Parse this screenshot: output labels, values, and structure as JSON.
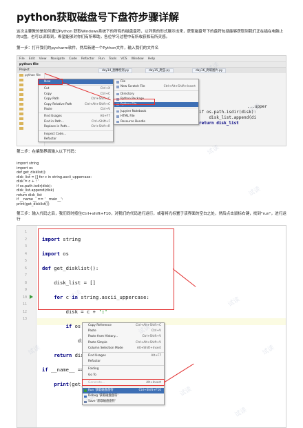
{
  "title": "python获取磁盘号下盘符步骤详解",
  "intro": "这次主要教的是如何通过Python 获取Windows系统下的所有的磁盘盘符，以列表的形式展示出来，获取磁盘号下的盘符包括能够获取到我们正在插在电脑上的U盘，也可以读取到，希望能够对你们有所帮助，各位学习过程中有所收获和有所灵感。",
  "step1": "第一步：打开我们的pycharm软件，然后新建一个Python文件，输入我们的文件名",
  "step2": "第二步：在编辑界面输入以下代码：",
  "step3": "第三步：输入代码之后，我们同时按住Ctrl+shift+F10，对我们的代码进行运行，或者将光标置于该界面的空白之处，然后点击鼠标右键，找到\"run\"，进行运行",
  "code_lines": [
    "import string",
    "import os",
    "def get_disklist():",
    "disk_list = [] for c in string.ascii_uppercase:",
    "disk = c + ':'",
    "if os.path.isdir(disk):",
    "disk_list.append(disk)",
    "return disk_list",
    "if __name__ == '__main__':",
    "print(get_disklist())"
  ],
  "shot1": {
    "menubar": [
      "File",
      "Edit",
      "View",
      "Navigate",
      "Code",
      "Refactor",
      "Run",
      "Tools",
      "VCS",
      "Window",
      "Help"
    ],
    "toolbar_label": "python file",
    "project_label": "Project",
    "tabs": [
      "day14_图像检测.py",
      "day15_爬虫.py",
      "day16_爬取图片.py"
    ],
    "tree_root": "python file",
    "context_menu": [
      {
        "label": "New",
        "shortcut": ""
      },
      {
        "label": "Cut",
        "shortcut": "Ctrl+X"
      },
      {
        "label": "Copy",
        "shortcut": "Ctrl+C"
      },
      {
        "label": "Copy Path",
        "shortcut": "Ctrl+Shift+C"
      },
      {
        "label": "Copy Relative Path",
        "shortcut": "Ctrl+Alt+Shift+C"
      },
      {
        "label": "Paste",
        "shortcut": "Ctrl+V"
      },
      {
        "label": "Find Usages",
        "shortcut": "Alt+F7"
      },
      {
        "label": "Find in Path...",
        "shortcut": "Ctrl+Shift+F"
      },
      {
        "label": "Replace in Path...",
        "shortcut": "Ctrl+Shift+R"
      },
      {
        "label": "Inspect Code...",
        "shortcut": ""
      },
      {
        "label": "Refactor",
        "shortcut": ""
      }
    ],
    "new_submenu": [
      {
        "label": "File",
        "shortcut": ""
      },
      {
        "label": "New Scratch File",
        "shortcut": "Ctrl+Alt+Shift+Insert"
      },
      {
        "label": "Directory",
        "shortcut": ""
      },
      {
        "label": "Python Package",
        "shortcut": ""
      },
      {
        "label": "Python File",
        "shortcut": ""
      },
      {
        "label": "Jupyter Notebook",
        "shortcut": ""
      },
      {
        "label": "HTML File",
        "shortcut": ""
      },
      {
        "label": "Resource Bundle",
        "shortcut": ""
      }
    ],
    "bg_code": [
      "...upper",
      "if os.path.isdir(disk):",
      "    disk_list.append(di",
      "return disk_list"
    ]
  },
  "shot2": {
    "line_numbers": [
      "1",
      "2",
      "3",
      "4",
      "5",
      "6",
      "7",
      "8",
      "9",
      "10",
      "11",
      "12",
      "13"
    ],
    "context_menu": [
      {
        "label": "Copy Reference",
        "shortcut": "Ctrl+Alt+Shift+C",
        "disabled": false
      },
      {
        "label": "Paste",
        "shortcut": "Ctrl+V",
        "disabled": false
      },
      {
        "label": "Paste from History...",
        "shortcut": "Ctrl+Shift+V",
        "disabled": false
      },
      {
        "label": "Paste Simple",
        "shortcut": "Ctrl+Alt+Shift+V",
        "disabled": false
      },
      {
        "label": "Column Selection Mode",
        "shortcut": "Alt+Shift+Insert",
        "disabled": false
      },
      {
        "label": "Find Usages",
        "shortcut": "Alt+F7",
        "disabled": false
      },
      {
        "label": "Refactor",
        "shortcut": "",
        "disabled": false
      },
      {
        "label": "Folding",
        "shortcut": "",
        "disabled": false
      },
      {
        "label": "Go To",
        "shortcut": "",
        "disabled": false
      },
      {
        "label": "Generate...",
        "shortcut": "Alt+Insert",
        "disabled": true
      },
      {
        "label": "Run '获取磁盘盘符'",
        "shortcut": "Ctrl+Shift+F10",
        "disabled": false
      },
      {
        "label": "Debug '获取磁盘盘符'",
        "shortcut": "",
        "disabled": false
      },
      {
        "label": "Save '获取磁盘盘符'",
        "shortcut": "",
        "disabled": false
      }
    ]
  },
  "watermark": "试读"
}
